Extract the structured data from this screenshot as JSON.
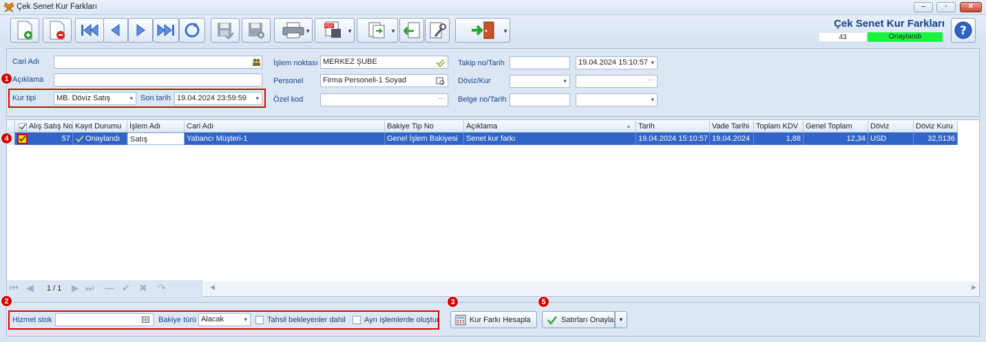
{
  "window": {
    "title": "Çek Senet Kur Farkları"
  },
  "header": {
    "title": "Çek Senet Kur Farkları",
    "record_no": "43",
    "status": "Onaylandı"
  },
  "filters": {
    "cari_adi_label": "Cari Adı",
    "cari_adi_value": "",
    "aciklama_label": "Açıklama",
    "aciklama_value": "",
    "kur_tipi_label": "Kur tipi",
    "kur_tipi_value": "MB. Döviz Satış",
    "son_tarih_label": "Son tarih",
    "son_tarih_value": "19.04.2024 23:59:59",
    "islem_noktasi_label": "İşlem noktası",
    "islem_noktasi_value": "MERKEZ ŞUBE",
    "personel_label": "Personel",
    "personel_value": "Firma Personeli-1 Soyad",
    "ozel_kod_label": "Özel kod",
    "ozel_kod_value": "",
    "takip_label": "Takip no/Tarih",
    "takip_no": "",
    "takip_tarih": "19.04.2024 15:10:57",
    "doviz_kur_label": "Döviz/Kur",
    "doviz_value": "",
    "kur_value": "",
    "belge_label": "Belge no/Tarih",
    "belge_no": "",
    "belge_tarih": ""
  },
  "grid": {
    "columns": [
      "Alış Satış No",
      "Kayıt Durumu",
      "İşlem Adı",
      "Cari Adı",
      "Bakiye Tip No",
      "Açıklama",
      "Tarih",
      "Vade Tarihi",
      "Toplam KDV",
      "Genel Toplam",
      "Döviz",
      "Döviz Kuru"
    ],
    "rows": [
      [
        "57",
        "Onaylandı",
        "Satış",
        "Yabancı Müşteri-1",
        "Genel İşlem Bakiyesi",
        "Senet kur farkı",
        "19.04.2024 15:10:57",
        "19.04.2024",
        "1,88",
        "12,34",
        "USD",
        "32,5136"
      ]
    ],
    "pager": "1 / 1"
  },
  "bottom": {
    "hizmet_stok_label": "Hizmet stok",
    "hizmet_stok_value": "",
    "bakiye_turu_label": "Bakiye türü",
    "bakiye_turu_value": "Alacak",
    "tahsil_label": "Tahsil bekleyenler dahil",
    "ayri_label": "Ayrı işlemlerde oluştur",
    "hesapla_label": "Kur Farkı Hesapla",
    "onayla_label": "Satırları Onayla"
  },
  "badges": [
    "1",
    "2",
    "3",
    "4",
    "5"
  ],
  "colors": {
    "status_green": "#1af23f",
    "selection": "#3264c8",
    "highlight_red": "#e00000"
  }
}
